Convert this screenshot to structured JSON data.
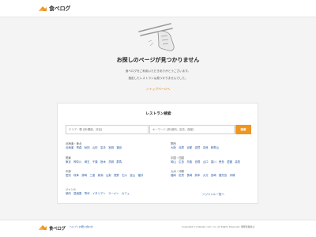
{
  "header": {
    "logo_text": "食べログ"
  },
  "notfound": {
    "title": "お探しのページが見つかりません",
    "message_line1": "食べログをご利用いただきありがとうございます。",
    "message_line2": "指定したレストランは見つかりませんでした。",
    "top_link": "＞トップページへ"
  },
  "search": {
    "title": "レストラン検索",
    "area_placeholder": "エリア・駅 [例:銀座、渋谷]",
    "keyword_placeholder": "キーワード [例:焼肉、店名、個室]",
    "button_label": "検索"
  },
  "regions": [
    {
      "label": "北海道・東北",
      "links": [
        "北海道",
        "青森",
        "秋田",
        "山形",
        "岩手",
        "宮城",
        "福島"
      ]
    },
    {
      "label": "関西",
      "links": [
        "大阪",
        "兵庫",
        "京都",
        "滋賀",
        "奈良",
        "和歌山"
      ]
    },
    {
      "label": "関東",
      "links": [
        "東京",
        "神奈川",
        "埼玉",
        "千葉",
        "栃木",
        "茨城",
        "群馬"
      ]
    },
    {
      "label": "中国・四国",
      "links": [
        "岡山",
        "広島",
        "鳥取",
        "島根",
        "山口",
        "香川",
        "徳島",
        "愛媛",
        "高知"
      ]
    },
    {
      "label": "中部",
      "links": [
        "愛知",
        "岐阜",
        "静岡",
        "三重",
        "新潟",
        "山梨",
        "長野",
        "石川",
        "富山",
        "福井"
      ]
    },
    {
      "label": "九州・沖縄",
      "links": [
        "福岡",
        "佐賀",
        "長崎",
        "熊本",
        "大分",
        "宮崎",
        "鹿児島",
        "沖縄"
      ]
    },
    {
      "label": "ジャンル",
      "links": [
        "焼肉",
        "居酒屋",
        "寿司",
        "イタリアン",
        "ラーメン",
        "カフェ"
      ]
    }
  ],
  "genre_more": "＞ジャンル一覧へ",
  "footer": {
    "logo_text": "食べログ",
    "links": "ヘルプ | お問い合わせ",
    "copyright": "Copyright (c) Kakaku.com, Inc. All Rights Reserved. 無断転載禁止"
  },
  "colors": {
    "accent": "#f0951f",
    "link": "#2a5ba5"
  }
}
